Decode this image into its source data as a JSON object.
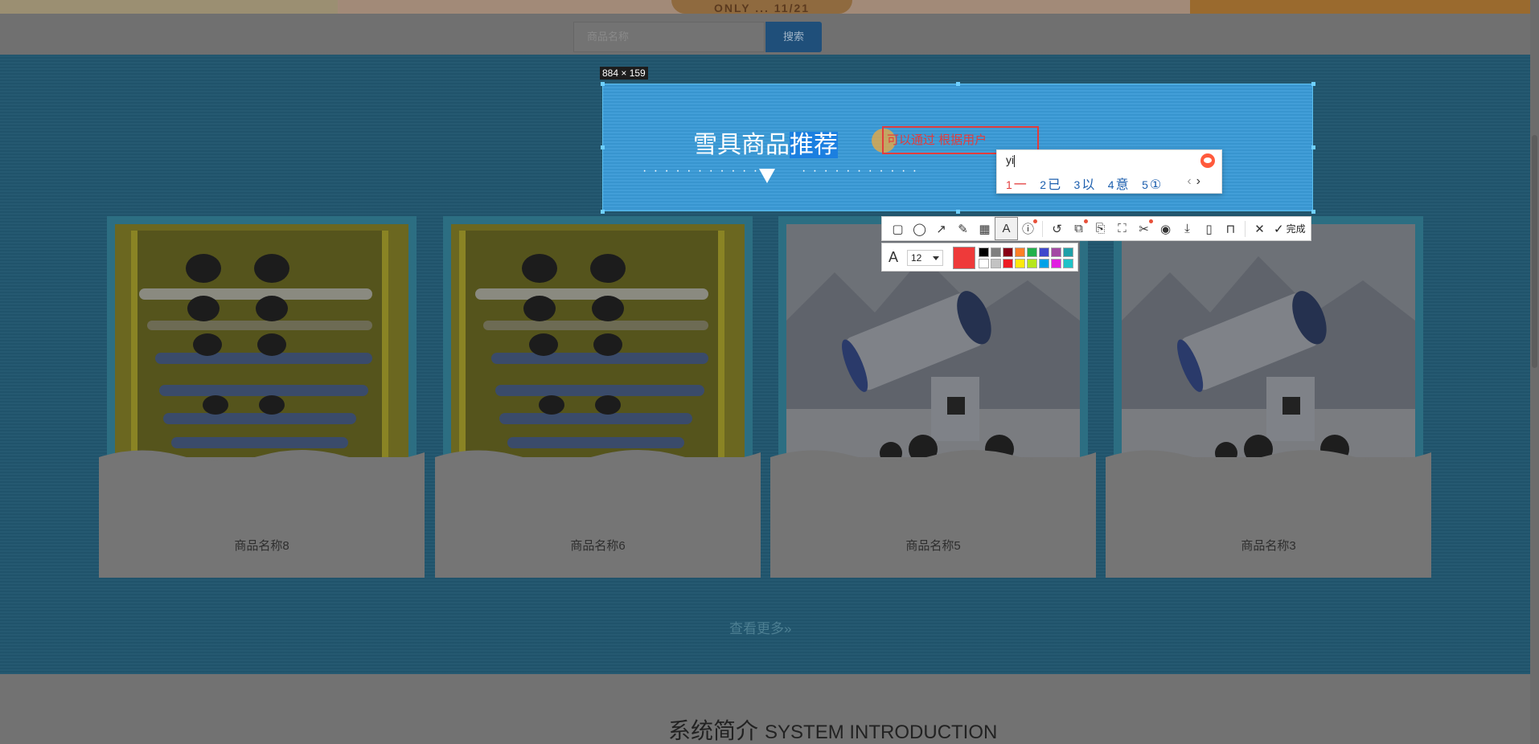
{
  "banner": {
    "promo": "ONLY ... 11/21"
  },
  "search": {
    "placeholder": "商品名称",
    "button": "搜索"
  },
  "capture": {
    "size_label": "884 × 159",
    "title_normal": "雪具商品",
    "title_selected": "推荐",
    "annotation_text": "可以通过 根据用户",
    "colors": {
      "current": "#ee3a3a",
      "palette": [
        "#000000",
        "#7f7f7f",
        "#880015",
        "#ed1c24",
        "#ff7f27",
        "#22b14c",
        "#00a2e8",
        "#3f48cc",
        "#ffffff",
        "#c3c3c3",
        "#b97a57",
        "#ffc90e",
        "#b5e61d",
        "#99d9ea",
        "#a349a4",
        "#1fc2c8"
      ]
    },
    "font_size": "12"
  },
  "ime": {
    "input": "yi",
    "candidates": [
      {
        "n": "1",
        "text": "一"
      },
      {
        "n": "2",
        "text": "已"
      },
      {
        "n": "3",
        "text": "以"
      },
      {
        "n": "4",
        "text": "意"
      },
      {
        "n": "5",
        "text": "①"
      }
    ],
    "prev": "‹",
    "next": "›"
  },
  "toolbar": {
    "done": "完成"
  },
  "products": [
    {
      "name": "商品名称8",
      "image": "snowboard-rack"
    },
    {
      "name": "商品名称6",
      "image": "snowboard-rack"
    },
    {
      "name": "商品名称5",
      "image": "snow-machine"
    },
    {
      "name": "商品名称3",
      "image": "snow-machine"
    }
  ],
  "more": "查看更多»",
  "intro": {
    "title_cn": "系统简介",
    "title_en": "SYSTEM INTRODUCTION"
  }
}
